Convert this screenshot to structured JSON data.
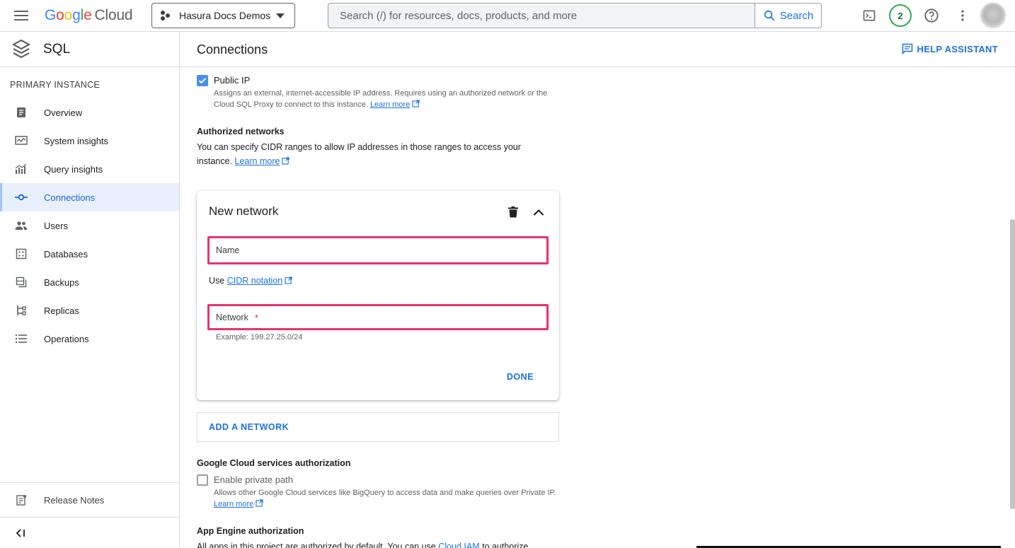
{
  "topbar": {
    "logo_parts": [
      "G",
      "o",
      "o",
      "g",
      "l",
      "e"
    ],
    "logo_suffix": "Cloud",
    "project_name": "Hasura Docs Demos",
    "search_placeholder": "Search (/) for resources, docs, products, and more",
    "search_button": "Search",
    "notifications_count": "2",
    "icons": [
      "menu-icon",
      "terminal-icon",
      "help-icon",
      "more-vert-icon"
    ]
  },
  "sidebar": {
    "product_title": "SQL",
    "section_label": "PRIMARY INSTANCE",
    "items": [
      {
        "label": "Overview",
        "icon": "overview-icon",
        "active": false
      },
      {
        "label": "System insights",
        "icon": "system-insights-icon",
        "active": false
      },
      {
        "label": "Query insights",
        "icon": "query-insights-icon",
        "active": false
      },
      {
        "label": "Connections",
        "icon": "connections-icon",
        "active": true
      },
      {
        "label": "Users",
        "icon": "users-icon",
        "active": false
      },
      {
        "label": "Databases",
        "icon": "databases-icon",
        "active": false
      },
      {
        "label": "Backups",
        "icon": "backups-icon",
        "active": false
      },
      {
        "label": "Replicas",
        "icon": "replicas-icon",
        "active": false
      },
      {
        "label": "Operations",
        "icon": "operations-icon",
        "active": false
      }
    ],
    "release_notes": "Release Notes"
  },
  "main": {
    "page_title": "Connections",
    "help_assistant": "HELP ASSISTANT",
    "public_ip": {
      "label": "Public IP",
      "checked": true,
      "hint": "Assigns an external, internet-accessible IP address. Requires using an authorized network or the Cloud SQL Proxy to connect to this instance.",
      "learn_more": "Learn more"
    },
    "authorized_networks": {
      "title": "Authorized networks",
      "text": "You can specify CIDR ranges to allow IP addresses in those ranges to access your instance.",
      "learn_more": "Learn more"
    },
    "new_network_card": {
      "title": "New network",
      "name_placeholder": "Name",
      "name_value": "",
      "use_prefix": "Use",
      "cidr_link": "CIDR notation",
      "network_placeholder": "Network",
      "network_required": "*",
      "network_value": "",
      "example": "Example: 199.27.25.0/24",
      "done": "DONE"
    },
    "add_network": "ADD A NETWORK",
    "gcs_authorization": {
      "title": "Google Cloud services authorization",
      "checkbox_label": "Enable private path",
      "checked": false,
      "hint": "Allows other Google Cloud services like BigQuery to access data and make queries over Private IP.",
      "learn_more": "Learn more"
    },
    "app_engine": {
      "title": "App Engine authorization",
      "text_start": "All apps in this project are authorized by default. You can use",
      "cloud_iam": "Cloud IAM",
      "text_end": "to authorize"
    }
  },
  "colors": {
    "accent": "#1a73e8",
    "highlight_border": "#e8336d",
    "active_bg": "#e8f0fe",
    "badge_green": "#34a853"
  }
}
